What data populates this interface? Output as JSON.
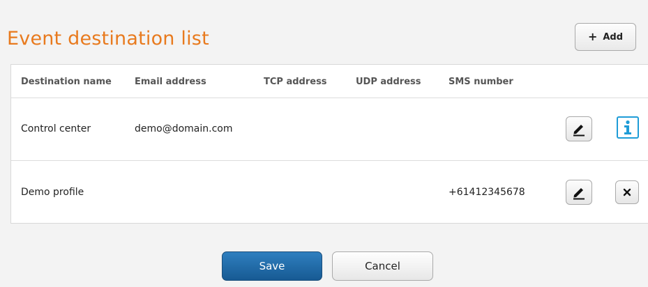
{
  "page": {
    "title": "Event destination list",
    "add_label": "Add",
    "add_icon": "+"
  },
  "table": {
    "headers": [
      "Destination name",
      "Email address",
      "TCP address",
      "UDP address",
      "SMS number"
    ],
    "rows": [
      {
        "name": "Control center",
        "email": "demo@domain.com",
        "tcp": "",
        "udp": "",
        "sms": "",
        "actions": [
          "edit-icon",
          "info-icon"
        ]
      },
      {
        "name": "Demo profile",
        "email": "",
        "tcp": "",
        "udp": "",
        "sms": "+61412345678",
        "actions": [
          "edit-icon",
          "close-icon"
        ]
      }
    ]
  },
  "footer": {
    "save_label": "Save",
    "cancel_label": "Cancel"
  },
  "colors": {
    "title": "#e87a1e",
    "save_bg": "#175a93",
    "info": "#1e9cd7"
  }
}
